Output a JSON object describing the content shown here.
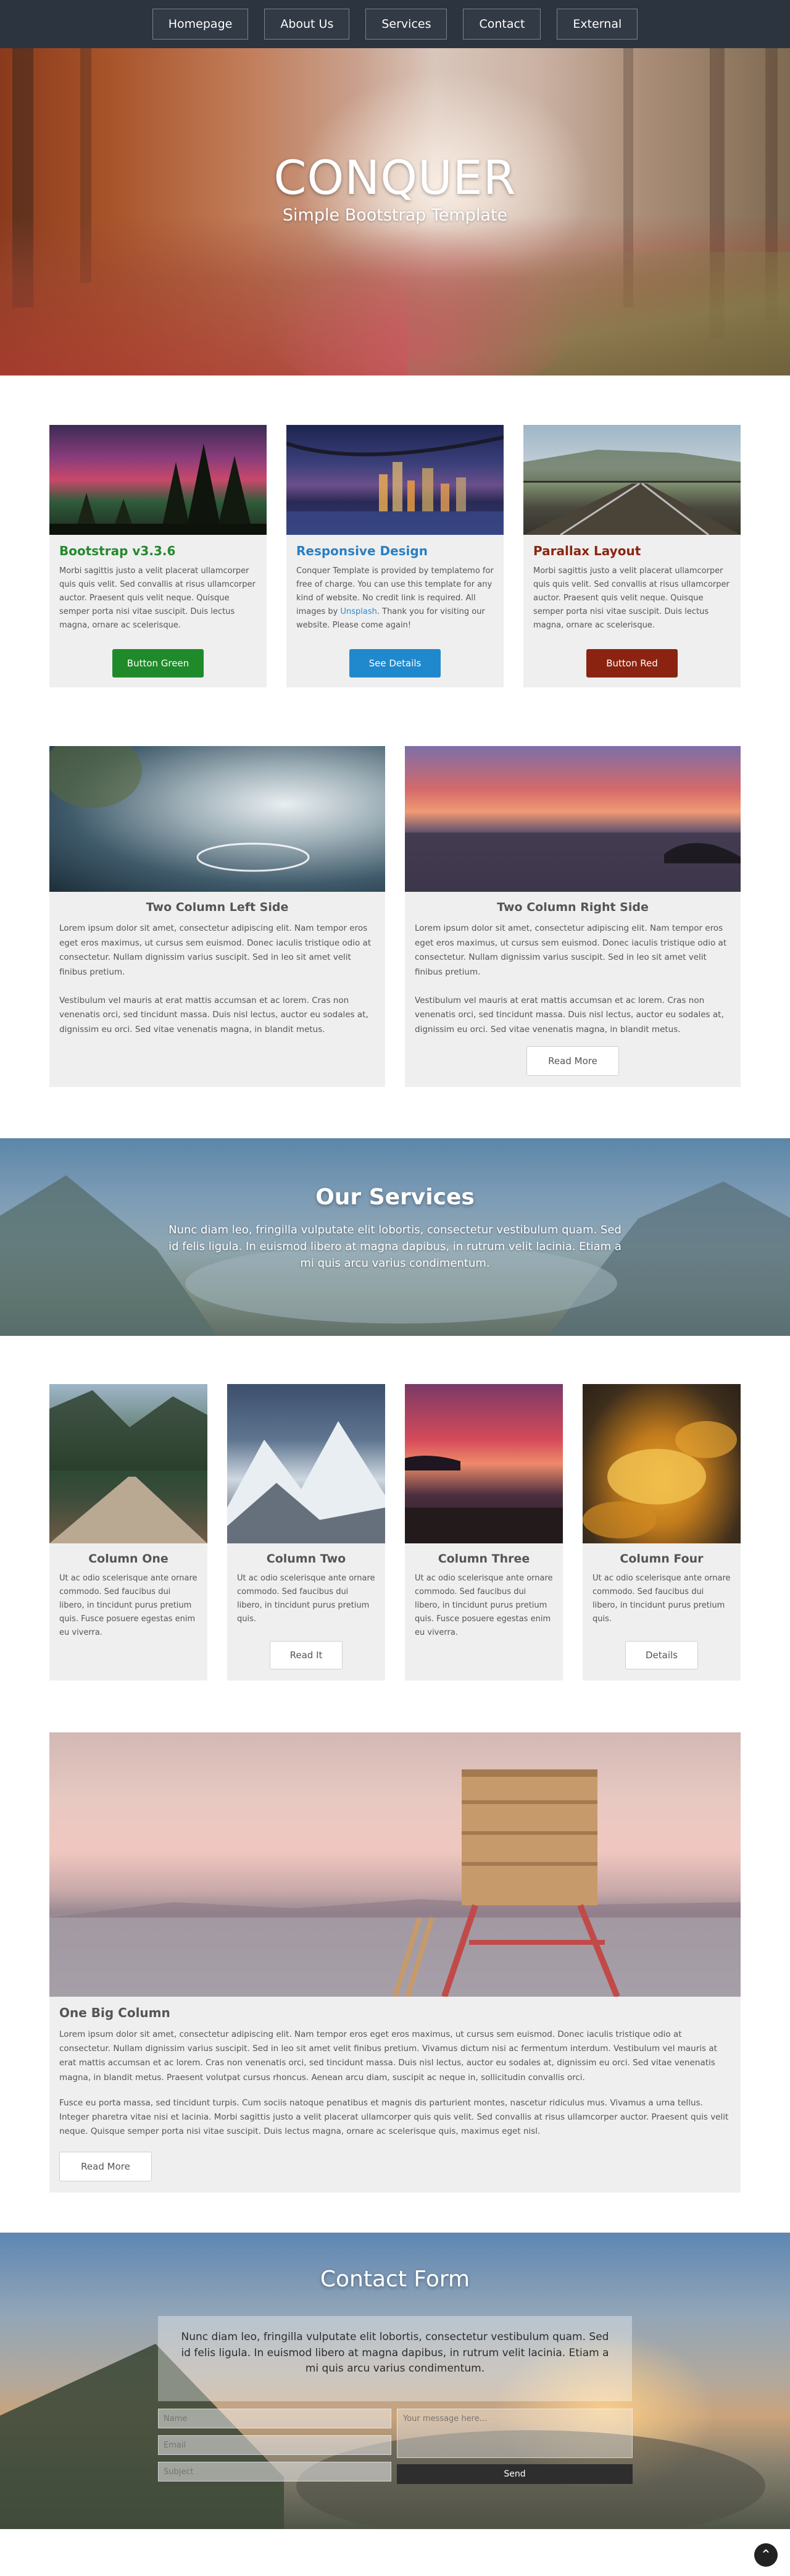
{
  "nav": {
    "items": [
      {
        "label": "Homepage"
      },
      {
        "label": "About Us"
      },
      {
        "label": "Services"
      },
      {
        "label": "Contact"
      },
      {
        "label": "External"
      }
    ]
  },
  "hero": {
    "title": "CONQUER",
    "subtitle": "Simple Bootstrap Template"
  },
  "features": [
    {
      "title": "Bootstrap v3.3.6",
      "title_color": "#26892c",
      "text": "Morbi sagittis justo a velit placerat ullamcorper quis quis velit. Sed convallis at risus ullamcorper auctor. Praesent quis velit neque. Quisque semper porta nisi vitae suscipit. Duis lectus magna, ornare ac scelerisque.",
      "button": "Button Green",
      "button_color": "#1f8a2a"
    },
    {
      "title": "Responsive Design",
      "title_color": "#2a7fc0",
      "text_before": "Conquer Template is provided by templatemo for free of charge. You can use this template for any kind of website. No credit link is required. All images by ",
      "link": "Unsplash",
      "text_after": ". Thank you for visiting our website. Please come again!",
      "button": "See Details",
      "button_color": "#2088cc"
    },
    {
      "title": "Parallax Layout",
      "title_color": "#8a2611",
      "text": "Morbi sagittis justo a velit placerat ullamcorper quis quis velit. Sed convallis at risus ullamcorper auctor. Praesent quis velit neque. Quisque semper porta nisi vitae suscipit. Duis lectus magna, ornare ac scelerisque.",
      "button": "Button Red",
      "button_color": "#8a230f"
    }
  ],
  "two_col": {
    "left": {
      "title": "Two Column Left Side",
      "p1": "Lorem ipsum dolor sit amet, consectetur adipiscing elit. Nam tempor eros eget eros maximus, ut cursus sem euismod. Donec iaculis tristique odio at consectetur. Nullam dignissim varius suscipit. Sed in leo sit amet velit finibus pretium.",
      "p2": "Vestibulum vel mauris at erat mattis accumsan et ac lorem. Cras non venenatis orci, sed tincidunt massa. Duis nisl lectus, auctor eu sodales at, dignissim eu orci. Sed vitae venenatis magna, in blandit metus."
    },
    "right": {
      "title": "Two Column Right Side",
      "p1": "Lorem ipsum dolor sit amet, consectetur adipiscing elit. Nam tempor eros eget eros maximus, ut cursus sem euismod. Donec iaculis tristique odio at consectetur. Nullam dignissim varius suscipit. Sed in leo sit amet velit finibus pretium.",
      "p2": "Vestibulum vel mauris at erat mattis accumsan et ac lorem. Cras non venenatis orci, sed tincidunt massa. Duis nisl lectus, auctor eu sodales at, dignissim eu orci. Sed vitae venenatis magna, in blandit metus.",
      "button": "Read More"
    }
  },
  "services": {
    "title": "Our Services",
    "text": "Nunc diam leo, fringilla vulputate elit lobortis, consectetur vestibulum quam. Sed id felis ligula. In euismod libero at magna dapibus, in rutrum velit lacinia. Etiam a mi quis arcu varius condimentum."
  },
  "four_col": [
    {
      "title": "Column One",
      "text": "Ut ac odio scelerisque ante ornare commodo. Sed faucibus dui libero, in tincidunt purus pretium quis. Fusce posuere egestas enim eu viverra.",
      "button": ""
    },
    {
      "title": "Column Two",
      "text": "Ut ac odio scelerisque ante ornare commodo. Sed faucibus dui libero, in tincidunt purus pretium quis.",
      "button": "Read It"
    },
    {
      "title": "Column Three",
      "text": "Ut ac odio scelerisque ante ornare commodo. Sed faucibus dui libero, in tincidunt purus pretium quis. Fusce posuere egestas enim eu viverra.",
      "button": ""
    },
    {
      "title": "Column Four",
      "text": "Ut ac odio scelerisque ante ornare commodo. Sed faucibus dui libero, in tincidunt purus pretium quis.",
      "button": "Details"
    }
  ],
  "big_col": {
    "title": "One Big Column",
    "p1": "Lorem ipsum dolor sit amet, consectetur adipiscing elit. Nam tempor eros eget eros maximus, ut cursus sem euismod. Donec iaculis tristique odio at consectetur. Nullam dignissim varius suscipit. Sed in leo sit amet velit finibus pretium. Vivamus dictum nisi ac fermentum interdum. Vestibulum vel mauris at erat mattis accumsan et ac lorem. Cras non venenatis orci, sed tincidunt massa. Duis nisl lectus, auctor eu sodales at, dignissim eu orci. Sed vitae venenatis magna, in blandit metus. Praesent volutpat cursus rhoncus. Aenean arcu diam, suscipit ac neque in, sollicitudin convallis orci.",
    "p2": "Fusce eu porta massa, sed tincidunt turpis. Cum sociis natoque penatibus et magnis dis parturient montes, nascetur ridiculus mus. Vivamus a urna tellus. Integer pharetra vitae nisi et lacinia. Morbi sagittis justo a velit placerat ullamcorper quis quis velit. Sed convallis at risus ullamcorper auctor. Praesent quis velit neque. Quisque semper porta nisi vitae suscipit. Duis lectus magna, ornare ac scelerisque quis, maximus eget nisl.",
    "button": "Read More"
  },
  "contact": {
    "title": "Contact Form",
    "text": "Nunc diam leo, fringilla vulputate elit lobortis, consectetur vestibulum quam. Sed id felis ligula. In euismod libero at magna dapibus, in rutrum velit lacinia. Etiam a mi quis arcu varius condimentum.",
    "name_placeholder": "Name",
    "email_placeholder": "Email",
    "subject_placeholder": "Subject",
    "message_placeholder": "Your message here...",
    "send_label": "Send"
  },
  "back_to_top_icon": "chevron-up-icon"
}
